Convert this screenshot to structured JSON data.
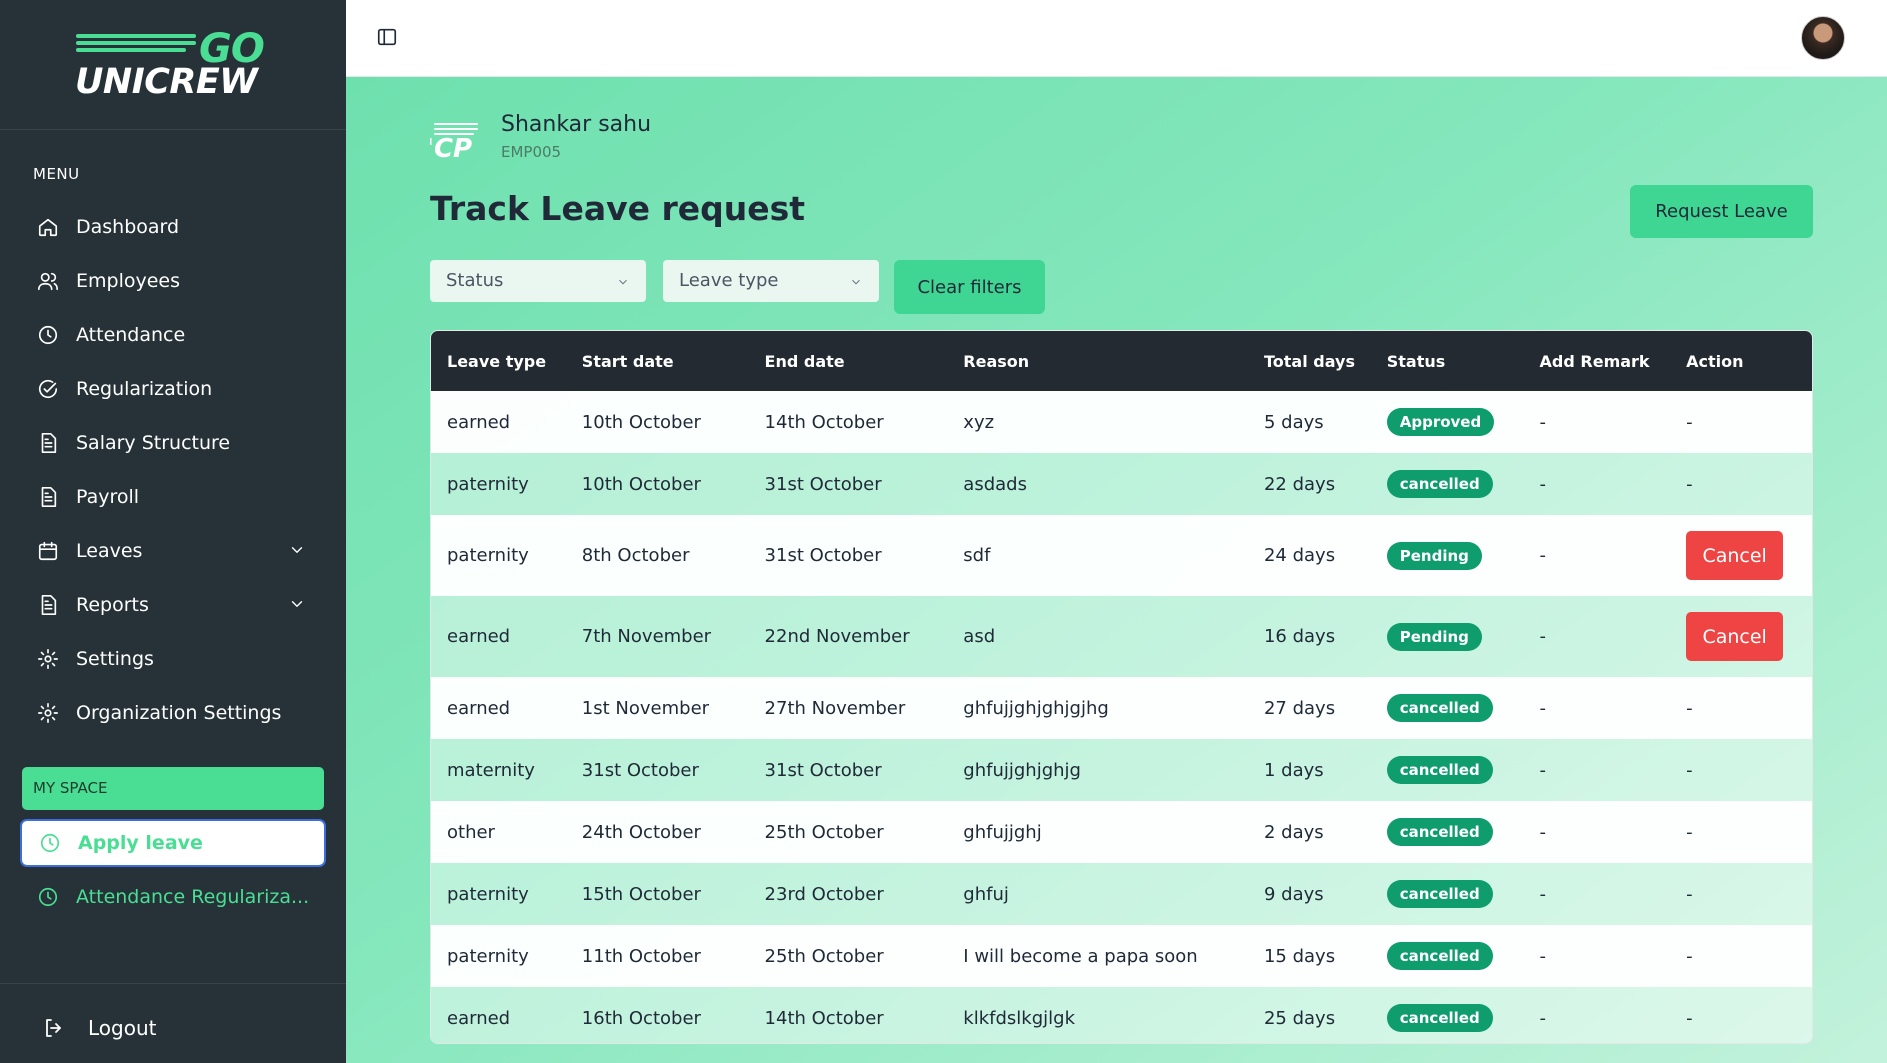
{
  "sidebar": {
    "logo": {
      "top": "GO",
      "bottom": "UNICREW"
    },
    "menu_title": "MENU",
    "items": [
      {
        "label": "Dashboard",
        "icon": "home-icon"
      },
      {
        "label": "Employees",
        "icon": "users-icon"
      },
      {
        "label": "Attendance",
        "icon": "clock-icon"
      },
      {
        "label": "Regularization",
        "icon": "check-circle-icon"
      },
      {
        "label": "Salary Structure",
        "icon": "document-icon"
      },
      {
        "label": "Payroll",
        "icon": "document-icon"
      },
      {
        "label": "Leaves",
        "icon": "calendar-icon",
        "expandable": true
      },
      {
        "label": "Reports",
        "icon": "document-icon",
        "expandable": true
      },
      {
        "label": "Settings",
        "icon": "gear-icon"
      },
      {
        "label": "Organization Settings",
        "icon": "gear-icon"
      }
    ],
    "my_space": {
      "title": "MY SPACE",
      "items": [
        {
          "label": "Apply leave",
          "icon": "clock-icon",
          "active": true
        },
        {
          "label": "Attendance Regulariza...",
          "icon": "clock-icon"
        }
      ]
    },
    "logout_label": "Logout"
  },
  "employee": {
    "logo_text": "'CP",
    "name": "Shankar sahu",
    "id": "EMP005"
  },
  "page": {
    "title": "Track Leave request",
    "request_button": "Request Leave"
  },
  "filters": {
    "status_placeholder": "Status",
    "leave_type_placeholder": "Leave type",
    "clear_label": "Clear filters"
  },
  "table": {
    "headers": [
      "Leave type",
      "Start date",
      "End date",
      "Reason",
      "Total days",
      "Status",
      "Add Remark",
      "Action"
    ],
    "rows": [
      {
        "leave_type": "earned",
        "start": "10th October",
        "end": "14th October",
        "reason": "xyz",
        "total": "5 days",
        "status": "Approved",
        "remark": "-",
        "action": "-"
      },
      {
        "leave_type": "paternity",
        "start": "10th October",
        "end": "31st October",
        "reason": "asdads",
        "total": "22 days",
        "status": "cancelled",
        "remark": "-",
        "action": "-"
      },
      {
        "leave_type": "paternity",
        "start": "8th October",
        "end": "31st October",
        "reason": "sdf",
        "total": "24 days",
        "status": "Pending",
        "remark": "-",
        "action": "Cancel"
      },
      {
        "leave_type": "earned",
        "start": "7th November",
        "end": "22nd November",
        "reason": "asd",
        "total": "16 days",
        "status": "Pending",
        "remark": "-",
        "action": "Cancel"
      },
      {
        "leave_type": "earned",
        "start": "1st November",
        "end": "27th November",
        "reason": "ghfujjghjghjgjhg",
        "total": "27 days",
        "status": "cancelled",
        "remark": "-",
        "action": "-"
      },
      {
        "leave_type": "maternity",
        "start": "31st October",
        "end": "31st October",
        "reason": "ghfujjghjghjg",
        "total": "1 days",
        "status": "cancelled",
        "remark": "-",
        "action": "-"
      },
      {
        "leave_type": "other",
        "start": "24th October",
        "end": "25th October",
        "reason": "ghfujjghj",
        "total": "2 days",
        "status": "cancelled",
        "remark": "-",
        "action": "-"
      },
      {
        "leave_type": "paternity",
        "start": "15th October",
        "end": "23rd October",
        "reason": "ghfuj",
        "total": "9 days",
        "status": "cancelled",
        "remark": "-",
        "action": "-"
      },
      {
        "leave_type": "paternity",
        "start": "11th October",
        "end": "25th October",
        "reason": "I will become a papa soon",
        "total": "15 days",
        "status": "cancelled",
        "remark": "-",
        "action": "-"
      },
      {
        "leave_type": "earned",
        "start": "16th October",
        "end": "14th October",
        "reason": "klkfdslkgjlgk",
        "total": "25 days",
        "status": "cancelled",
        "remark": "-",
        "action": "-"
      }
    ]
  },
  "colors": {
    "sidebar_bg": "#263238",
    "accent": "#4ade94",
    "status_badge": "#0f9d6e",
    "cancel": "#ef4444",
    "table_header": "#232a31"
  }
}
